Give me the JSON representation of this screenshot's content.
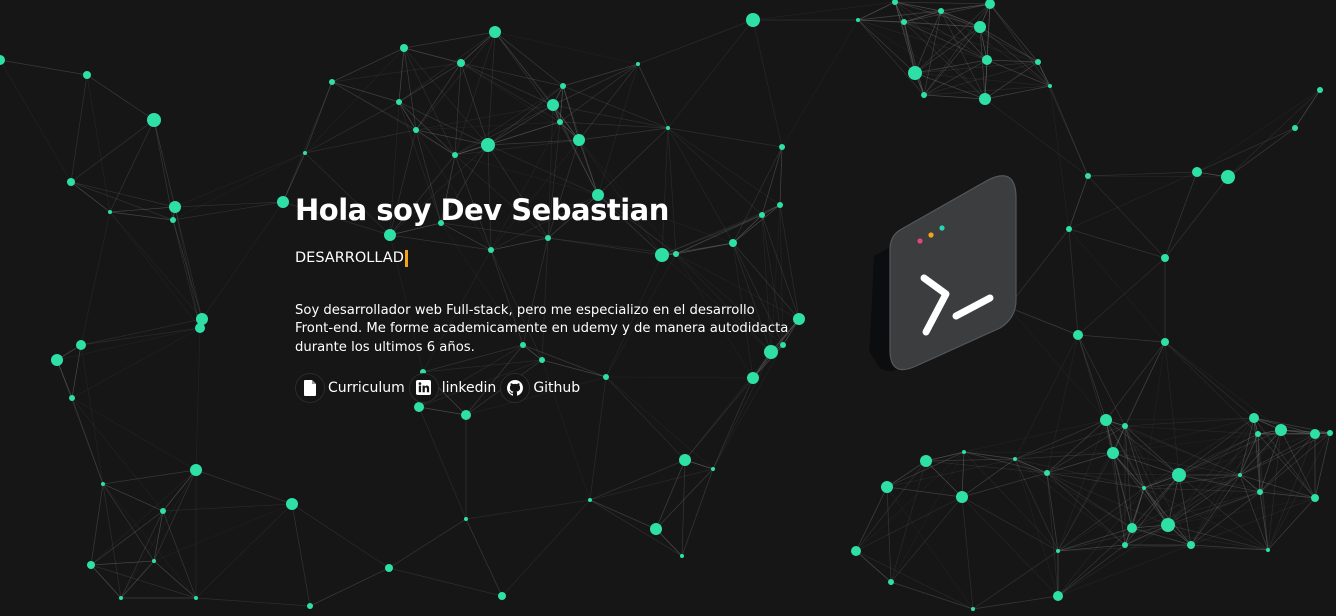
{
  "hero": {
    "title": "Hola soy Dev Sebastian",
    "typed_text": "DESARROLLAD",
    "description": "Soy desarrollador web Full-stack, pero me especializo en el desarrollo Front-end. Me forme academicamente en udemy y de manera autodidacta durante los ultimos 6 años."
  },
  "links": [
    {
      "label": "Curriculum",
      "icon": "document-icon"
    },
    {
      "label": "linkedin",
      "icon": "linkedin-icon"
    },
    {
      "label": "Github",
      "icon": "github-icon"
    }
  ],
  "terminal": {
    "prompt_glyph": ">_",
    "dot_colors": [
      "#e0457b",
      "#f5a11a",
      "#27d6b0"
    ]
  },
  "colors": {
    "background": "#161617",
    "node": "#2fe0a6",
    "line": "#8a8a8a",
    "cursor": "#f5a11a",
    "text": "#ffffff"
  }
}
